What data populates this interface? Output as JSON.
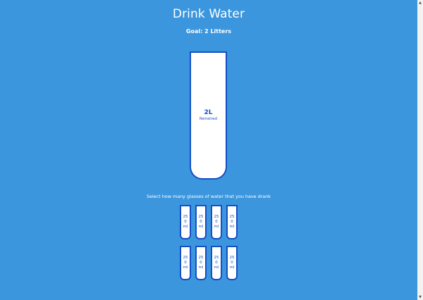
{
  "app": {
    "title": "Drink Water",
    "goal": "Goal: 2 Litters"
  },
  "cup": {
    "remained_amount": "2L",
    "remained_label": "Remained"
  },
  "instruction": "Select how many glasses of water that you have drank",
  "glasses": [
    {
      "label": "250 ml"
    },
    {
      "label": "250 ml"
    },
    {
      "label": "250 ml"
    },
    {
      "label": "250 ml"
    },
    {
      "label": "250 ml"
    },
    {
      "label": "250 ml"
    },
    {
      "label": "250 ml"
    },
    {
      "label": "250 ml"
    }
  ],
  "colors": {
    "background": "#3c96dd",
    "accent": "#144fc6",
    "cup_fill": "#ffffff"
  }
}
